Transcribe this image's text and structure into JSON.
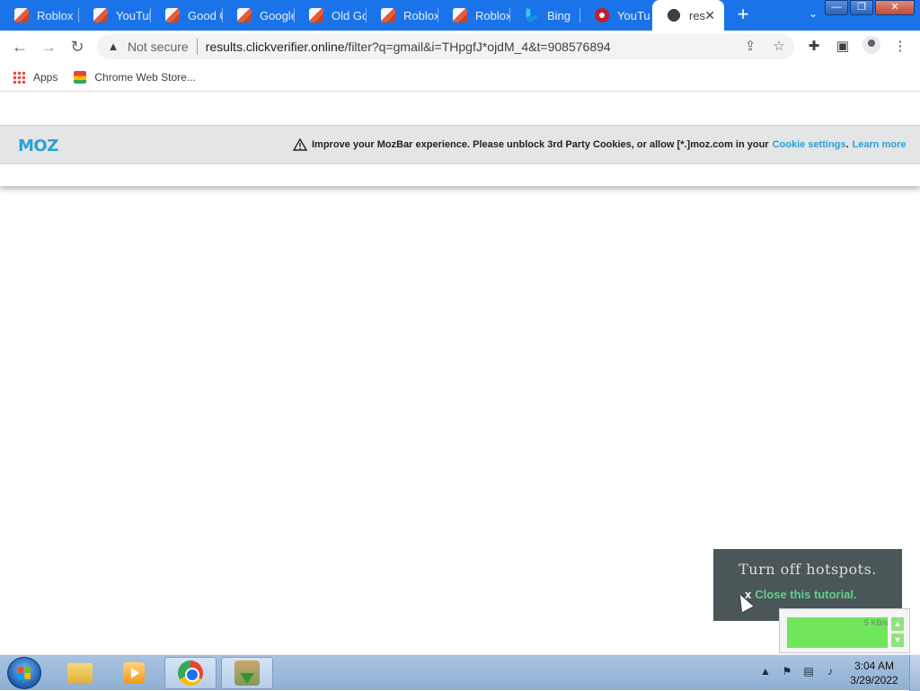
{
  "browser": {
    "tabs": [
      {
        "label": "Roblox",
        "icon": "roblox-icon"
      },
      {
        "label": "YouTube",
        "icon": "roblox-icon"
      },
      {
        "label": "Good C",
        "icon": "roblox-icon"
      },
      {
        "label": "Google",
        "icon": "roblox-icon"
      },
      {
        "label": "Old Go",
        "icon": "roblox-icon"
      },
      {
        "label": "Roblox",
        "icon": "roblox-icon"
      },
      {
        "label": "Roblox",
        "icon": "roblox-icon"
      },
      {
        "label": "Bing",
        "icon": "bing-icon"
      },
      {
        "label": "YouTub",
        "icon": "youtube-icon"
      },
      {
        "label": "res",
        "icon": "globe-icon",
        "active": true
      }
    ],
    "omnibox": {
      "security_label": "Not secure",
      "url_host": "results.clickverifier.online",
      "url_path": "/filter?q=gmail&i=THpgfJ*ojdM_4&t=908576894"
    },
    "bookmarks": [
      {
        "label": "Apps"
      },
      {
        "label": "Chrome Web Store..."
      }
    ]
  },
  "mozbar": {
    "logo": "MOZ",
    "message": "Improve your MozBar experience. Please unblock 3rd Party Cookies, or allow [*.]moz.com in your",
    "cookie_link": "Cookie settings",
    "learn_more": "Learn more",
    "period": "."
  },
  "tutorial": {
    "title": "Turn off hotspots.",
    "close_x": "x",
    "close_label": "Close this tutorial."
  },
  "netmeter": {
    "speed": "5 KB/s"
  },
  "taskbar": {
    "time": "3:04 AM",
    "date": "3/29/2022"
  },
  "colors": {
    "chrome_frame": "#1a73e8",
    "moz_blue": "#2aa2d6",
    "tutorial_bg": "#4b5659",
    "tutorial_link": "#5fd08a"
  }
}
